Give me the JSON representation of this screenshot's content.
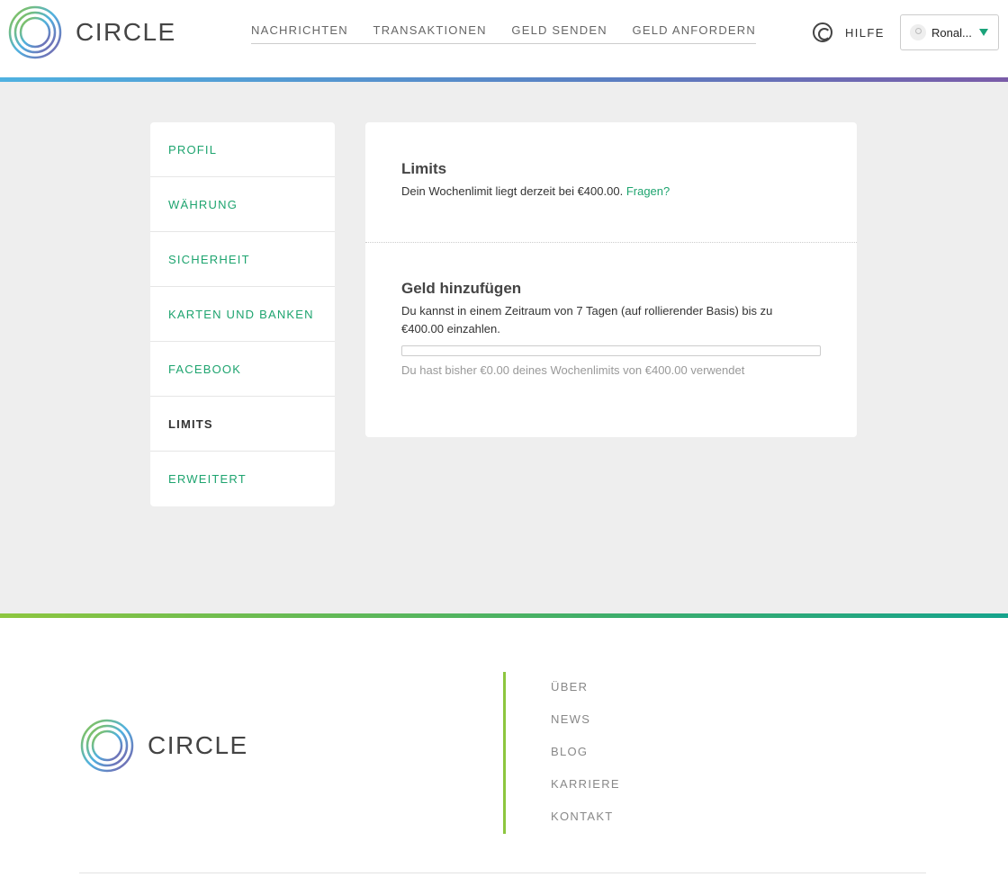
{
  "brand": {
    "name": "CIRCLE",
    "colors": {
      "accent": "#1ea46f",
      "logo_green": "#8dc63f",
      "logo_blue": "#4fb1e0",
      "logo_purple": "#7a5ba8"
    }
  },
  "header": {
    "nav": [
      "NACHRICHTEN",
      "TRANSAKTIONEN",
      "GELD SENDEN",
      "GELD ANFORDERN"
    ],
    "help_label": "HILFE",
    "help_icon": "lifebuoy-icon",
    "user_name": "Ronal..."
  },
  "sidebar": {
    "items": [
      {
        "label": "PROFIL",
        "active": false
      },
      {
        "label": "WÄHRUNG",
        "active": false
      },
      {
        "label": "SICHERHEIT",
        "active": false
      },
      {
        "label": "KARTEN UND BANKEN",
        "active": false
      },
      {
        "label": "FACEBOOK",
        "active": false
      },
      {
        "label": "LIMITS",
        "active": true
      },
      {
        "label": "ERWEITERT",
        "active": false
      }
    ]
  },
  "limits": {
    "title": "Limits",
    "text": "Dein Wochenlimit liegt derzeit bei €400.00.",
    "link": "Fragen?"
  },
  "add_money": {
    "title": "Geld hinzufügen",
    "text_line1": "Du kannst in einem Zeitraum von 7 Tagen (auf rollierender Basis) bis zu",
    "text_line2": "€400.00 einzahlen.",
    "progress_fraction": 0,
    "usage_text": "Du hast bisher €0.00 deines Wochenlimits von €400.00 verwendet"
  },
  "footer": {
    "links": [
      "ÜBER",
      "NEWS",
      "BLOG",
      "KARRIERE",
      "KONTAKT"
    ]
  }
}
